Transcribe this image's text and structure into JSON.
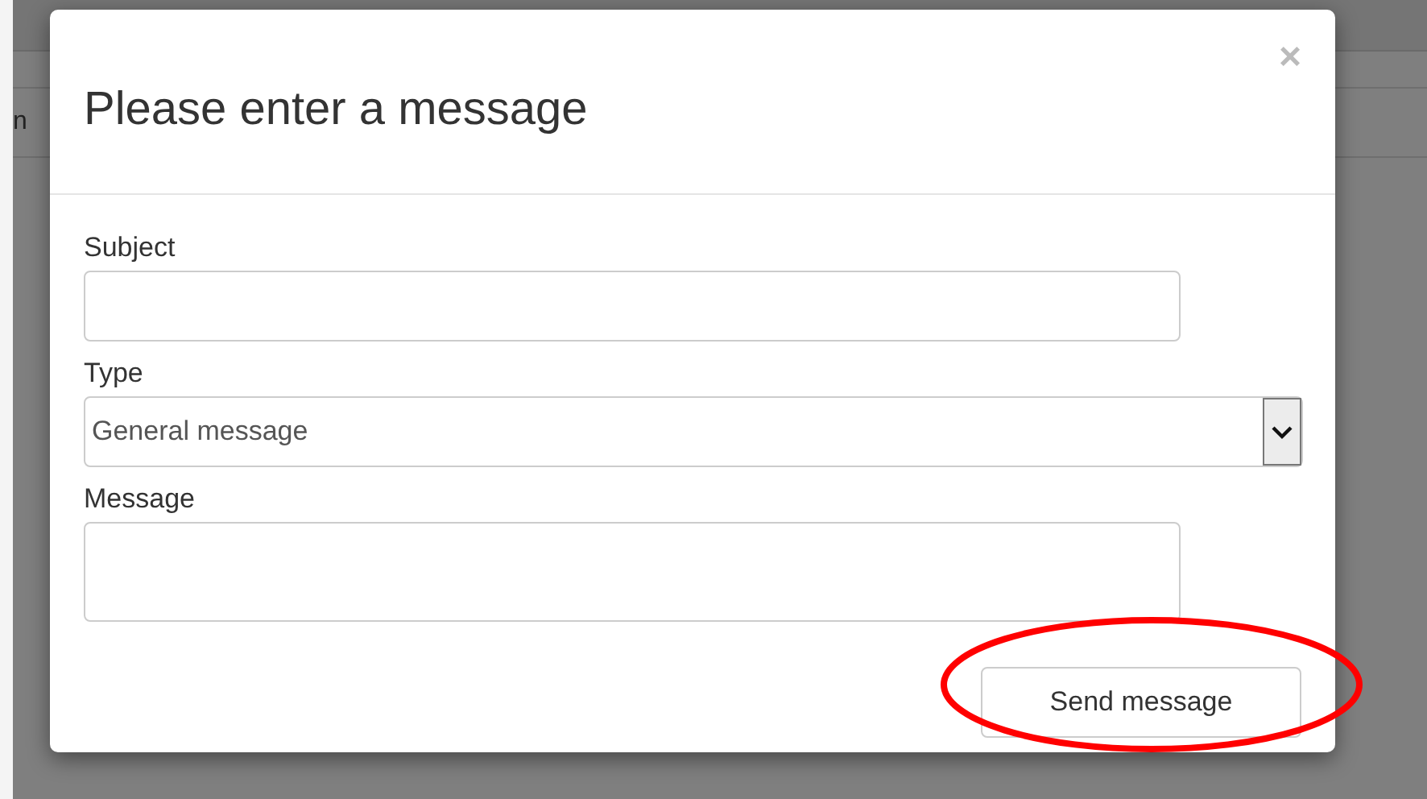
{
  "background_page": {
    "partial_text": "n"
  },
  "dialog": {
    "title": "Please enter a message",
    "close": "×",
    "fields": [
      {
        "kind": "text",
        "label": "Subject"
      },
      {
        "kind": "select",
        "label": "Type",
        "value": "General message"
      },
      {
        "kind": "textarea",
        "label": "Message"
      }
    ],
    "button": "Send message"
  },
  "annotation": {
    "kind": "ellipse"
  }
}
